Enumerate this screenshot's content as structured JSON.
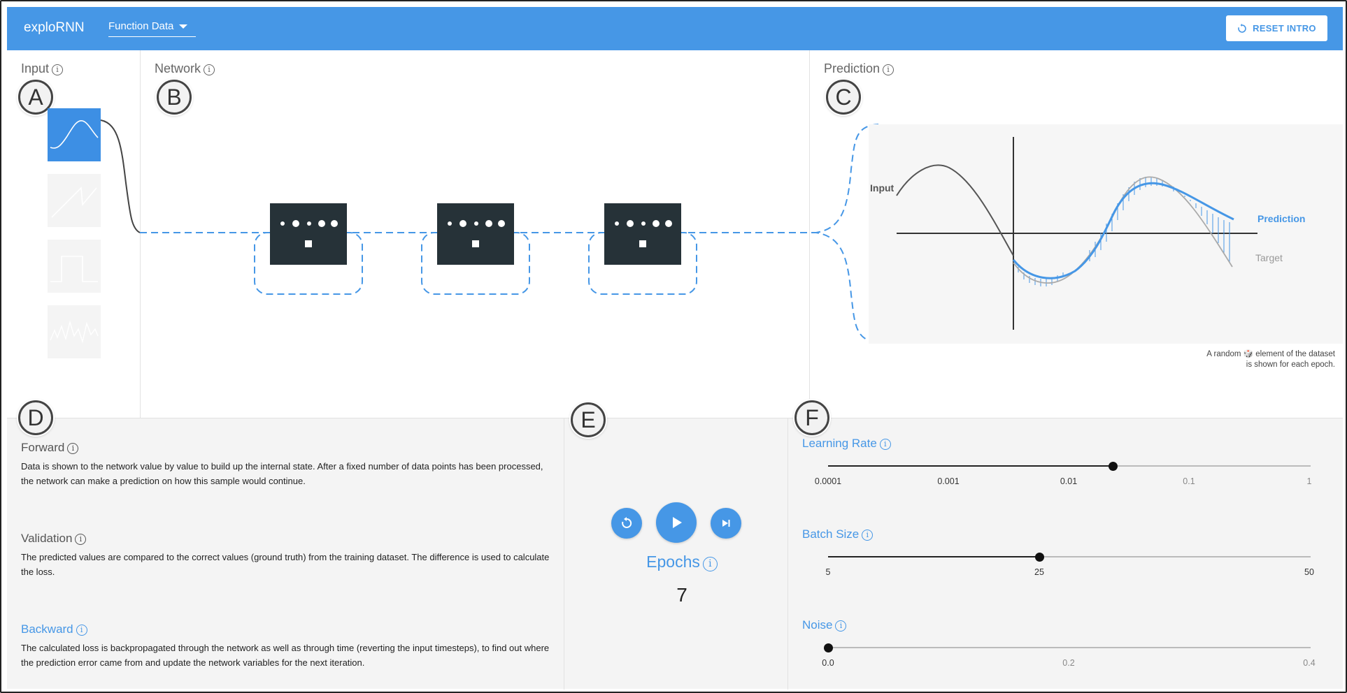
{
  "header": {
    "app_title": "exploRNN",
    "dataset_select": "Function Data",
    "reset_label": "RESET INTRO"
  },
  "sections": {
    "input": "Input",
    "network": "Network",
    "prediction": "Prediction"
  },
  "info_glyph": "i",
  "badges": {
    "a": "A",
    "b": "B",
    "c": "C",
    "d": "D",
    "e": "E",
    "f": "F"
  },
  "input_thumbnails": [
    "sine-wave-icon",
    "sawtooth-wave-icon",
    "square-wave-icon",
    "noise-wave-icon"
  ],
  "network": {
    "cell_count": 3
  },
  "prediction_plot": {
    "input_label": "Input",
    "prediction_label": "Prediction",
    "target_label": "Target",
    "caption_line1": "A random 🎲 element of the dataset",
    "caption_line2": "is shown for each epoch."
  },
  "phases": [
    {
      "title": "Forward",
      "text": "Data is shown to the network value by value to build up the internal state. After a fixed number of data points has been processed, the network can make a prediction on how this sample would continue.",
      "active": false
    },
    {
      "title": "Validation",
      "text": "The predicted values are compared to the correct values (ground truth) from the training dataset. The difference is used to calculate the loss.",
      "active": false
    },
    {
      "title": "Backward",
      "text": "The calculated loss is backpropagated through the network as well as through time (reverting the input timesteps), to find out where the prediction error came from and update the network variables for the next iteration.",
      "active": true
    }
  ],
  "training": {
    "epochs_label": "Epochs",
    "epochs_value": "7"
  },
  "params": {
    "learning_rate": {
      "label": "Learning Rate",
      "ticks": [
        "0.0001",
        "0.001",
        "0.01",
        "0.1",
        "1"
      ],
      "value_fraction": 0.59
    },
    "batch_size": {
      "label": "Batch Size",
      "ticks": [
        "5",
        "25",
        "50"
      ],
      "value": 25
    },
    "noise": {
      "label": "Noise",
      "ticks": [
        "0.0",
        "0.2",
        "0.4"
      ],
      "value": 0.0
    }
  },
  "colors": {
    "accent": "#4697e6",
    "cell": "#263238",
    "thumb_active": "#3d8fe4"
  }
}
